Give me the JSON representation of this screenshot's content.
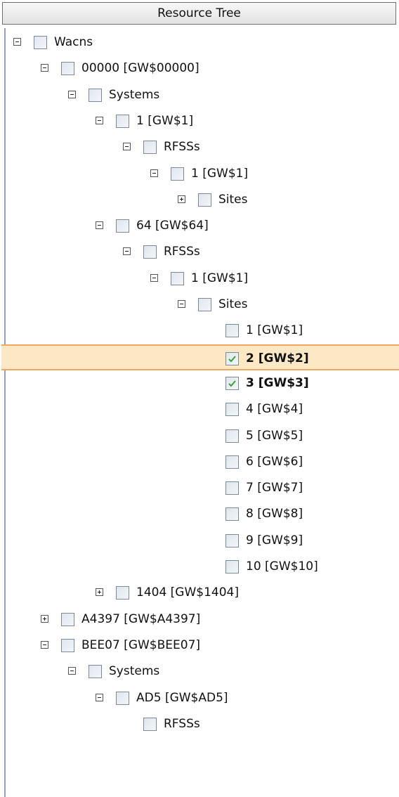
{
  "header": {
    "title": "Resource Tree"
  },
  "tree": {
    "rows": [
      {
        "label": "Wacns",
        "expander": "minus",
        "checked": false,
        "bold": false,
        "selected": false
      },
      {
        "label": "00000 [GW$00000]",
        "expander": "minus",
        "checked": false,
        "bold": false,
        "selected": false
      },
      {
        "label": "Systems",
        "expander": "minus",
        "checked": false,
        "bold": false,
        "selected": false
      },
      {
        "label": "1 [GW$1]",
        "expander": "minus",
        "checked": false,
        "bold": false,
        "selected": false
      },
      {
        "label": "RFSSs",
        "expander": "minus",
        "checked": false,
        "bold": false,
        "selected": false
      },
      {
        "label": "1 [GW$1]",
        "expander": "minus",
        "checked": false,
        "bold": false,
        "selected": false
      },
      {
        "label": "Sites",
        "expander": "plus",
        "checked": false,
        "bold": false,
        "selected": false
      },
      {
        "label": "64 [GW$64]",
        "expander": "minus",
        "checked": false,
        "bold": false,
        "selected": false
      },
      {
        "label": "RFSSs",
        "expander": "minus",
        "checked": false,
        "bold": false,
        "selected": false
      },
      {
        "label": "1 [GW$1]",
        "expander": "minus",
        "checked": false,
        "bold": false,
        "selected": false
      },
      {
        "label": "Sites",
        "expander": "minus",
        "checked": false,
        "bold": false,
        "selected": false
      },
      {
        "label": "1 [GW$1]",
        "expander": "none",
        "checked": false,
        "bold": false,
        "selected": false
      },
      {
        "label": "2 [GW$2]",
        "expander": "none",
        "checked": true,
        "bold": true,
        "selected": true
      },
      {
        "label": "3 [GW$3]",
        "expander": "none",
        "checked": true,
        "bold": true,
        "selected": false
      },
      {
        "label": "4 [GW$4]",
        "expander": "none",
        "checked": false,
        "bold": false,
        "selected": false
      },
      {
        "label": "5 [GW$5]",
        "expander": "none",
        "checked": false,
        "bold": false,
        "selected": false
      },
      {
        "label": "6 [GW$6]",
        "expander": "none",
        "checked": false,
        "bold": false,
        "selected": false
      },
      {
        "label": "7 [GW$7]",
        "expander": "none",
        "checked": false,
        "bold": false,
        "selected": false
      },
      {
        "label": "8 [GW$8]",
        "expander": "none",
        "checked": false,
        "bold": false,
        "selected": false
      },
      {
        "label": "9 [GW$9]",
        "expander": "none",
        "checked": false,
        "bold": false,
        "selected": false
      },
      {
        "label": "10 [GW$10]",
        "expander": "none",
        "checked": false,
        "bold": false,
        "selected": false
      },
      {
        "label": "1404 [GW$1404]",
        "expander": "plus",
        "checked": false,
        "bold": false,
        "selected": false
      },
      {
        "label": "A4397 [GW$A4397]",
        "expander": "plus",
        "checked": false,
        "bold": false,
        "selected": false
      },
      {
        "label": "BEE07 [GW$BEE07]",
        "expander": "minus",
        "checked": false,
        "bold": false,
        "selected": false
      },
      {
        "label": "Systems",
        "expander": "minus",
        "checked": false,
        "bold": false,
        "selected": false
      },
      {
        "label": "AD5 [GW$AD5]",
        "expander": "minus",
        "checked": false,
        "bold": false,
        "selected": false
      },
      {
        "label": "RFSSs",
        "expander": "none",
        "checked": false,
        "bold": false,
        "selected": false
      }
    ]
  },
  "colors": {
    "selection_fill": "#fde8c6",
    "selection_border": "#f0a860",
    "check_mark": "#3aa03a",
    "tree_border": "#8aa4cc"
  },
  "icons": {
    "expand": "plus-box-icon",
    "collapse": "minus-box-icon",
    "checkbox": "checkbox-icon",
    "check": "checkmark-icon"
  }
}
